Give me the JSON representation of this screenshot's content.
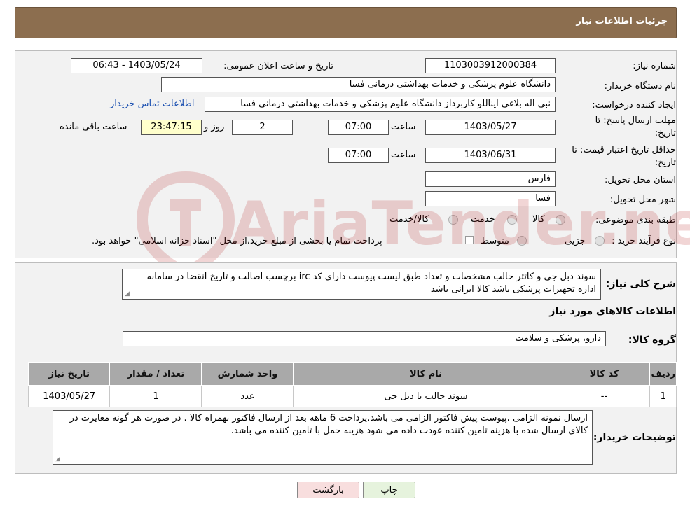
{
  "header": {
    "title": "جزئیات اطلاعات نیاز"
  },
  "need_number": {
    "label": "شماره نیاز:",
    "value": "1103003912000384"
  },
  "announce_datetime": {
    "label": "تاریخ و ساعت اعلان عمومی:",
    "value": "1403/05/24 - 06:43"
  },
  "buyer_org": {
    "label": "نام دستگاه خریدار:",
    "value": "دانشگاه علوم پزشکی و خدمات بهداشتی درمانی فسا"
  },
  "requester": {
    "label": "ایجاد کننده درخواست:",
    "value": "نبی اله بلاغی ایناللو کاربرداز دانشگاه علوم پزشکی و خدمات بهداشتی درمانی فسا",
    "contact_link": "اطلاعات تماس خریدار"
  },
  "reply_deadline": {
    "label_line1": "مهلت ارسال پاسخ: تا",
    "label_line2": "تاریخ:",
    "date": "1403/05/27",
    "time_label": "ساعت",
    "time": "07:00",
    "days": "2",
    "days_label": "روز و",
    "remaining": "23:47:15",
    "remaining_label": "ساعت باقی مانده"
  },
  "price_validity": {
    "label_line1": "حداقل تاریخ اعتبار قیمت: تا",
    "label_line2": "تاریخ:",
    "date": "1403/06/31",
    "time_label": "ساعت",
    "time": "07:00"
  },
  "province": {
    "label": "استان محل تحویل:",
    "value": "فارس"
  },
  "city": {
    "label": "شهر محل تحویل:",
    "value": "فسا"
  },
  "category": {
    "label": "طبقه بندی موضوعی:",
    "options": [
      "کالا",
      "خدمت",
      "کالا/خدمت"
    ]
  },
  "purchase_type": {
    "label": "نوع فرآیند خرید :",
    "options": [
      "جزیی",
      "متوسط"
    ],
    "note": "پرداخت تمام یا بخشی از مبلغ خرید،از محل \"اسناد خزانه اسلامی\" خواهد بود."
  },
  "description": {
    "label": "شرح کلی نیاز:",
    "value": "سوند دبل جی و کاتتر حالب  مشخصات و تعداد طبق لیست پیوست دارای کد irc  برچسب اصالت و تاریخ انقضا در سامانه اداره تجهیزات پزشکی باشد کالا ایرانی باشد"
  },
  "items_section": {
    "title": "اطلاعات کالاهای مورد نیاز"
  },
  "goods_group": {
    "label": "گروه کالا:",
    "value": "دارو، پزشکی و سلامت"
  },
  "table": {
    "headers": [
      "ردیف",
      "کد کالا",
      "نام کالا",
      "واحد شمارش",
      "تعداد / مقدار",
      "تاریخ نیاز"
    ],
    "rows": [
      [
        "1",
        "--",
        "سوند حالب یا دبل جی",
        "عدد",
        "1",
        "1403/05/27"
      ]
    ]
  },
  "buyer_notes": {
    "label": "توضیحات خریدار:",
    "value": "ارسال نمونه الزامی ،پیوست پیش فاکتور الزامی می باشد.پرداخت 6 ماهه بعد از ارسال فاکتور بهمراه کالا . در صورت هر گونه مغایرت در کالای ارسال شده با هزینه تامین کننده  عودت داده می شود  هزینه حمل با تامین  کننده می باشد."
  },
  "buttons": {
    "print": "چاپ",
    "back": "بازگشت"
  },
  "watermark": {
    "text": "AriaTender.neT"
  },
  "colors": {
    "header_bg": "#8c6e4f",
    "panel_bg": "#f2f2f2",
    "table_header": "#a9a9a9",
    "back_button": "#f8dede",
    "print_button": "#e6f3dd",
    "link": "#1a4fb0"
  }
}
